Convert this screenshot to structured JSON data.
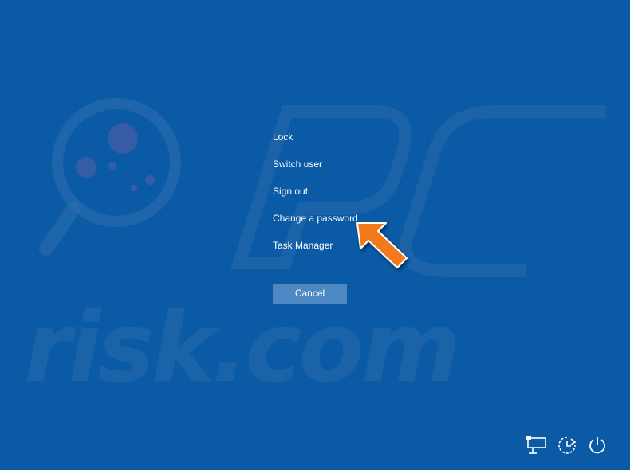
{
  "menu": {
    "items": [
      {
        "label": "Lock"
      },
      {
        "label": "Switch user"
      },
      {
        "label": "Sign out"
      },
      {
        "label": "Change a password"
      },
      {
        "label": "Task Manager"
      }
    ],
    "cancel_label": "Cancel"
  },
  "watermark": {
    "text": "risk.com",
    "logo_letters": "PC"
  },
  "tray": {
    "icons": [
      "network-icon",
      "accessibility-icon",
      "power-icon"
    ]
  },
  "colors": {
    "background": "#0a5aa6",
    "button": "#4d88c2",
    "arrow": "#f27a1a",
    "text": "#ffffff"
  }
}
